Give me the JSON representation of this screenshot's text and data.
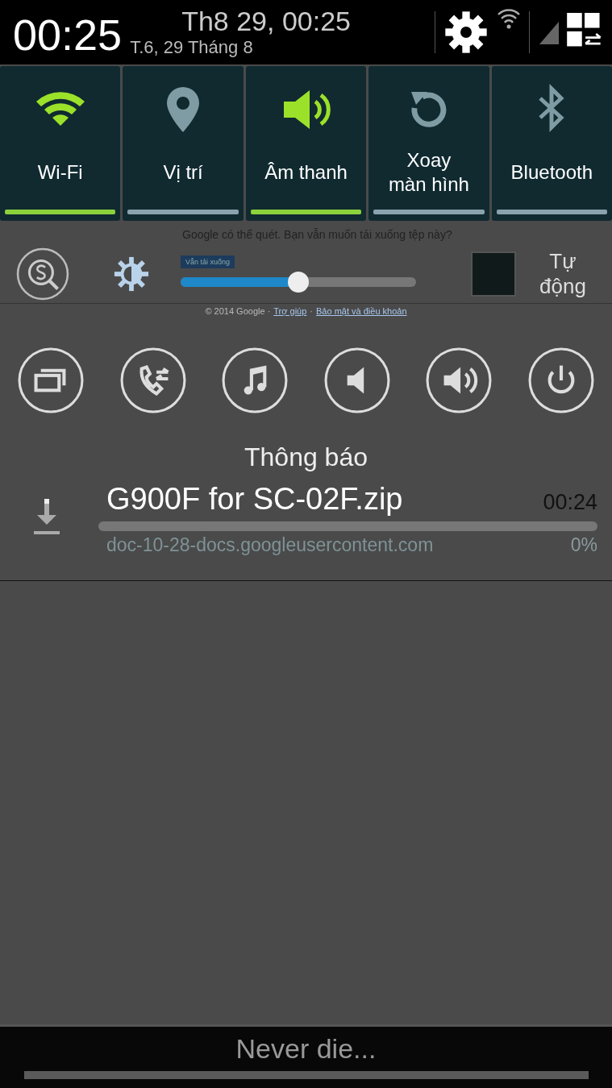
{
  "status_bar": {
    "time": "00:25",
    "date": "T.6, 29 Tháng 8",
    "datetime": "Th8 29, 00:25"
  },
  "quick_settings": [
    {
      "label": "Wi-Fi",
      "kind": "wifi",
      "on": true
    },
    {
      "label": "Vị trí",
      "kind": "location",
      "on": false
    },
    {
      "label": "Âm thanh",
      "kind": "sound",
      "on": true
    },
    {
      "label": "Xoay\nmàn hình",
      "kind": "rotate",
      "on": false
    },
    {
      "label": "Bluetooth",
      "kind": "bluetooth",
      "on": false
    }
  ],
  "background_page": {
    "message": "Google có thể quét. Bạn vẫn muốn tải xuống tệp này?",
    "button": "Vẫn tải xuống",
    "footer": [
      {
        "kind": "text",
        "text": "© 2014 Google ·"
      },
      {
        "kind": "link",
        "text": "Trợ giúp"
      },
      {
        "kind": "text",
        "text": "·"
      },
      {
        "kind": "link",
        "text": "Bảo mật và điều khoản"
      }
    ]
  },
  "brightness": {
    "level": 0.5,
    "auto_label": "Tự động",
    "auto_checked": false
  },
  "shortcuts": [
    {
      "kind": "multiwindow"
    },
    {
      "kind": "call"
    },
    {
      "kind": "music"
    },
    {
      "kind": "mute"
    },
    {
      "kind": "sound"
    },
    {
      "kind": "power"
    }
  ],
  "notifications": {
    "header": "Thông báo",
    "items": [
      {
        "title": "G900F for SC-02F.zip",
        "time": "00:24",
        "source": "doc-10-28-docs.googleusercontent.com",
        "percent": "0%",
        "level": 0
      }
    ]
  },
  "footer": {
    "carrier": "Never die..."
  }
}
